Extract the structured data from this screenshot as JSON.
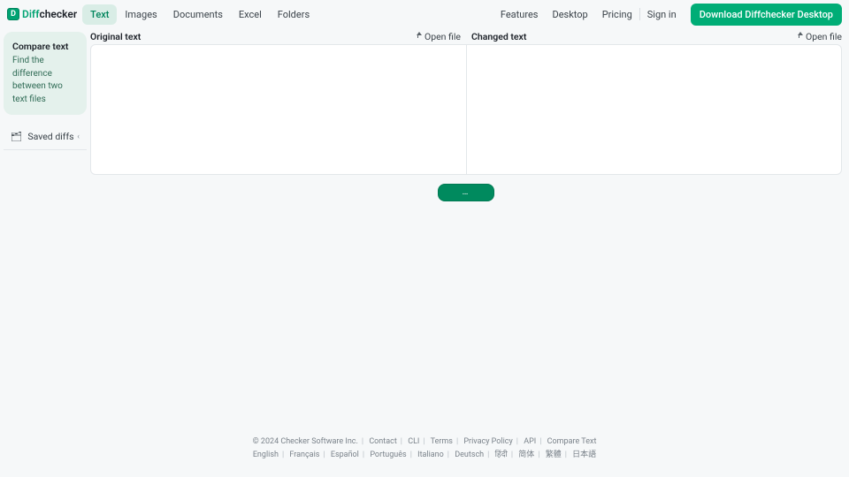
{
  "brand": {
    "badge": "D",
    "part1": "Diff",
    "part2": "checker"
  },
  "nav": {
    "items": [
      {
        "label": "Text",
        "active": true
      },
      {
        "label": "Images",
        "active": false
      },
      {
        "label": "Documents",
        "active": false
      },
      {
        "label": "Excel",
        "active": false
      },
      {
        "label": "Folders",
        "active": false
      }
    ]
  },
  "header_right": {
    "links": [
      "Features",
      "Desktop",
      "Pricing",
      "Sign in"
    ],
    "download": "Download Diffchecker Desktop"
  },
  "sidebar": {
    "card": {
      "title": "Compare text",
      "desc": "Find the difference between two text files"
    },
    "saved_diffs": {
      "icon": "🗂",
      "label": "Saved diffs"
    }
  },
  "panes": {
    "left": {
      "title": "Original text",
      "open": "Open file",
      "value": ""
    },
    "right": {
      "title": "Changed text",
      "open": "Open file",
      "value": ""
    }
  },
  "find_button": {
    "label": "…"
  },
  "footer": {
    "line1": [
      "© 2024 Checker Software Inc.",
      "Contact",
      "CLI",
      "Terms",
      "Privacy Policy",
      "API",
      "Compare Text"
    ],
    "line2": [
      "English",
      "Français",
      "Español",
      "Português",
      "Italiano",
      "Deutsch",
      "हिंदी",
      "简体",
      "繁體",
      "日本語"
    ]
  }
}
